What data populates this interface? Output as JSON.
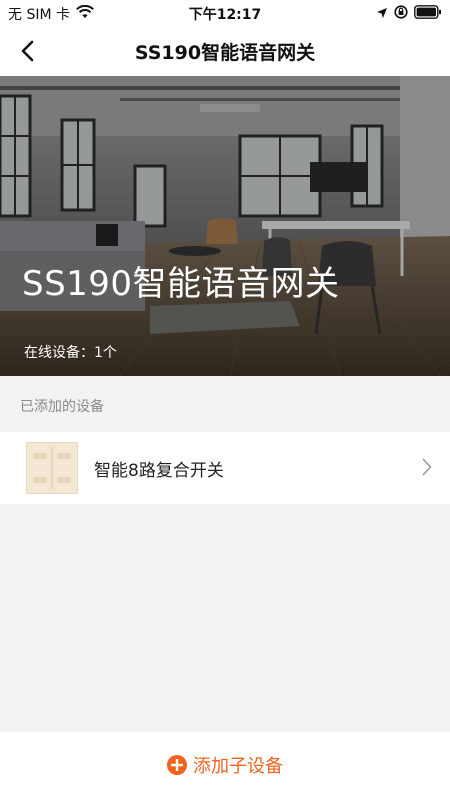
{
  "status_bar": {
    "carrier": "无 SIM 卡",
    "time": "下午12:17",
    "wifi_icon": "wifi-icon",
    "location_icon": "location-arrow-icon",
    "lock_icon": "rotation-lock-icon",
    "battery_icon": "battery-icon"
  },
  "nav": {
    "title": "SS190智能语音网关",
    "back_icon": "chevron-left-icon"
  },
  "hero": {
    "title": "SS190智能语音网关",
    "online_label": "在线设备：1个"
  },
  "section": {
    "added_devices_label": "已添加的设备"
  },
  "devices": [
    {
      "name": "智能8路复合开关",
      "icon": "switch-panel-thumbnail"
    }
  ],
  "footer": {
    "add_label": "添加子设备",
    "add_icon": "plus-circle-icon"
  },
  "colors": {
    "accent": "#f0641e",
    "background": "#f2f2f2"
  }
}
